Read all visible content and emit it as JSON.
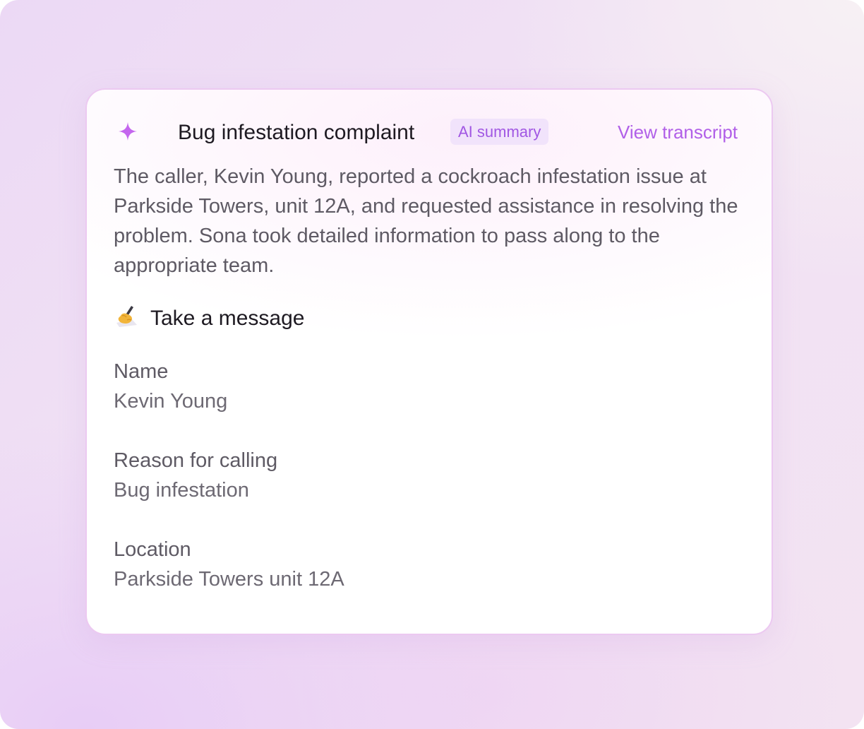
{
  "card": {
    "icon": "sparkle-icon",
    "title": "Bug infestation complaint",
    "badge": "AI summary",
    "view_transcript": "View transcript",
    "summary": "The caller, Kevin Young, reported a cockroach infestation issue at Parkside Towers, unit 12A, and requested assistance in resolving the problem. Sona took detailed information to pass along to the appropriate team.",
    "section": {
      "icon": "writing-hand-icon",
      "title": "Take a message"
    },
    "fields": [
      {
        "label": "Name",
        "value": "Kevin Young"
      },
      {
        "label": "Reason for calling",
        "value": "Bug infestation"
      },
      {
        "label": "Location",
        "value": "Parkside Towers unit 12A"
      }
    ]
  },
  "colors": {
    "accent": "#b160e8",
    "badge_bg": "#f1e3fb",
    "badge_text": "#a157e3",
    "card_border": "#ecc9f1",
    "title_text": "#1e1a22",
    "body_text": "#5e5a64"
  }
}
